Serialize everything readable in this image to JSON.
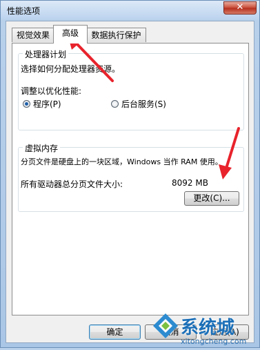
{
  "window": {
    "title": "性能选项",
    "close_symbol": "✕"
  },
  "tabs": [
    {
      "label": "视觉效果",
      "active": false
    },
    {
      "label": "高级",
      "active": true
    },
    {
      "label": "数据执行保护",
      "active": false
    }
  ],
  "processor": {
    "title": "处理器计划",
    "description": "选择如何分配处理器资源。",
    "adjust_label": "调整以优化性能:",
    "options": [
      {
        "label": "程序(P)",
        "checked": true
      },
      {
        "label": "后台服务(S)",
        "checked": false
      }
    ]
  },
  "virtual_memory": {
    "title": "虚拟内存",
    "description": "分页文件是硬盘上的一块区域，Windows 当作 RAM 使用。",
    "total_label": "所有驱动器总分页文件大小:",
    "total_value": "8092 MB",
    "change_button": "更改(C)..."
  },
  "footer": {
    "ok_button": "确定",
    "cancel_button": "取消",
    "apply_button": "应用(A)"
  },
  "watermark": {
    "brand": "系统城",
    "url": "xitongcheng.com"
  },
  "colors": {
    "annotation_arrow": "#e8232c",
    "accent": "#1f5fa8"
  }
}
